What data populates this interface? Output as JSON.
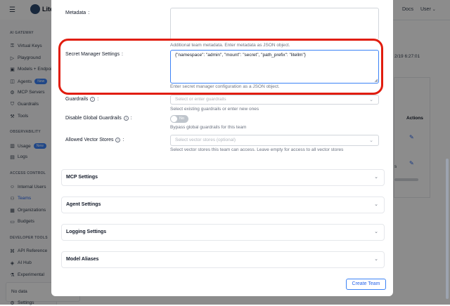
{
  "topbar": {
    "logo": "Lite",
    "docs": "Docs",
    "user": "User",
    "menu_icon": "hamburger-icon"
  },
  "sidebar": {
    "ai_gateway": "AI GATEWAY",
    "observability": "OBSERVABILITY",
    "access_control": "ACCESS CONTROL",
    "developer_tools": "DEVELOPER TOOLS",
    "items": [
      {
        "label": "Virtual Keys",
        "icon": "key-icon"
      },
      {
        "label": "Playground",
        "icon": "play-icon"
      },
      {
        "label": "Models + Endpoints",
        "icon": "box-icon"
      },
      {
        "label": "Agents",
        "icon": "robot-icon",
        "badge": "New"
      },
      {
        "label": "MCP Servers",
        "icon": "server-icon"
      },
      {
        "label": "Guardrails",
        "icon": "shield-icon"
      },
      {
        "label": "Tools",
        "icon": "wrench-icon"
      },
      {
        "label": "Usage",
        "icon": "chart-icon",
        "badge": "New"
      },
      {
        "label": "Logs",
        "icon": "file-icon"
      },
      {
        "label": "Internal Users",
        "icon": "user-icon"
      },
      {
        "label": "Teams",
        "icon": "team-icon"
      },
      {
        "label": "Organizations",
        "icon": "org-icon"
      },
      {
        "label": "Budgets",
        "icon": "wallet-icon"
      },
      {
        "label": "API Reference",
        "icon": "api-icon"
      },
      {
        "label": "AI Hub",
        "icon": "hub-icon"
      },
      {
        "label": "Experimental",
        "icon": "flask-icon"
      },
      {
        "label": "Settings",
        "icon": "gear-icon"
      }
    ],
    "no_data": "No data"
  },
  "background": {
    "timestamp": "2/19 6:27:01",
    "actions": "Actions",
    "text_s": "s"
  },
  "modal": {
    "metadata": {
      "label": "Metadata",
      "help": "Additional team metadata. Enter metadata as JSON object."
    },
    "secret_manager": {
      "label": "Secret Manager Settings",
      "value": "{\"namespace\": \"admin\", \"mount\": \"secret\", \"path_prefix\": \"litellm\"}",
      "help": "Enter secret manager configuration as a JSON object."
    },
    "guardrails": {
      "label": "Guardrails",
      "placeholder": "Select or enter guardrails",
      "help": "Select existing guardrails or enter new ones"
    },
    "disable_global": {
      "label": "Disable Global Guardrails",
      "toggle": "No",
      "help": "Bypass global guardrails for this team"
    },
    "vector_stores": {
      "label": "Allowed Vector Stores",
      "placeholder": "Select vector stores (optional)",
      "help": "Select vector stores this team can access. Leave empty for access to all vector stores"
    },
    "sections": [
      "MCP Settings",
      "Agent Settings",
      "Logging Settings",
      "Model Aliases"
    ],
    "create_button": "Create Team"
  },
  "highlight_color": "#e11d0f"
}
